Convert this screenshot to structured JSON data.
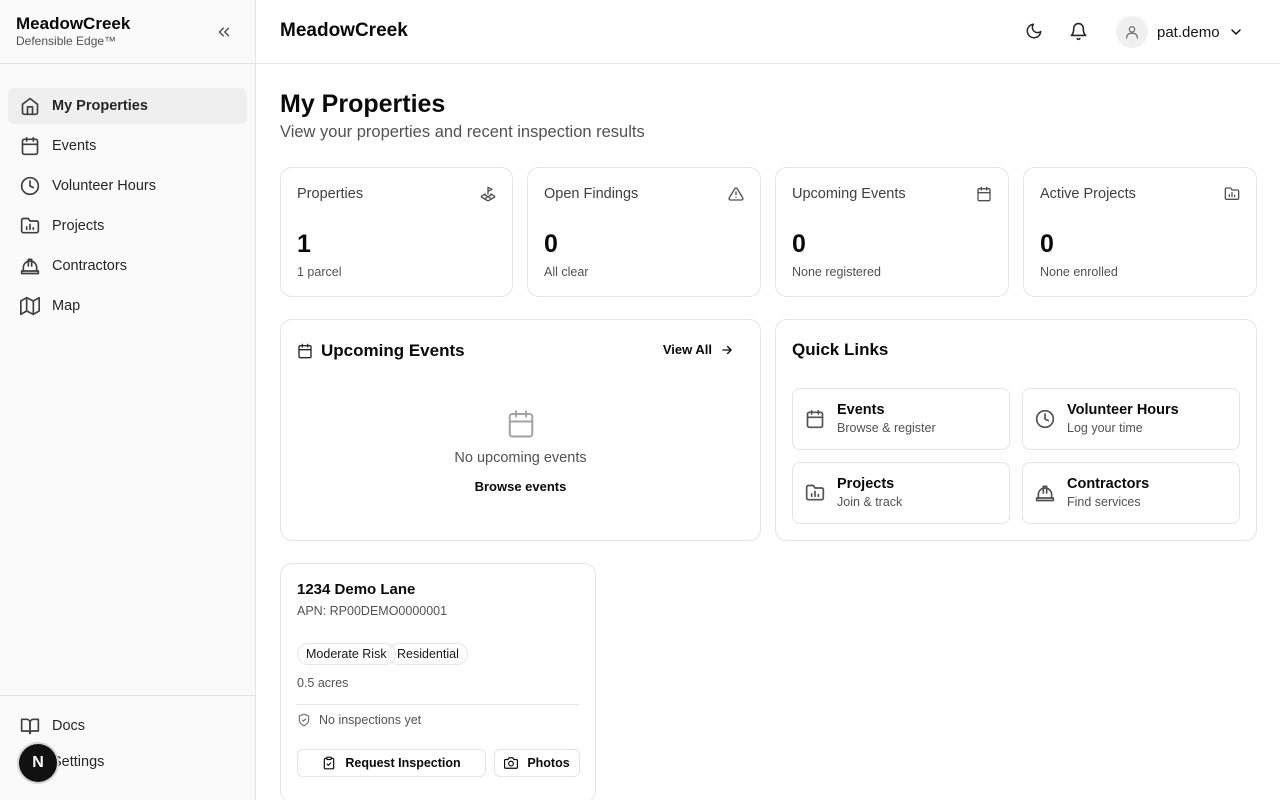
{
  "sidebar": {
    "brand_name": "MeadowCreek",
    "brand_sub": "Defensible Edge™",
    "items": [
      {
        "label": "My Properties",
        "icon": "home-icon"
      },
      {
        "label": "Events",
        "icon": "calendar-icon"
      },
      {
        "label": "Volunteer Hours",
        "icon": "clock-icon"
      },
      {
        "label": "Projects",
        "icon": "folder-chart-icon"
      },
      {
        "label": "Contractors",
        "icon": "hard-hat-icon"
      },
      {
        "label": "Map",
        "icon": "map-icon"
      }
    ],
    "bottom_items": [
      {
        "label": "Docs",
        "icon": "book-icon"
      },
      {
        "label": "Settings",
        "icon": "gear-icon"
      }
    ],
    "fab_letter": "N"
  },
  "header": {
    "title": "MeadowCreek",
    "username": "pat.demo"
  },
  "page": {
    "title": "My Properties",
    "subtitle": "View your properties and recent inspection results"
  },
  "stats": [
    {
      "label": "Properties",
      "value": "1",
      "note": "1 parcel",
      "icon": "land-plot-icon"
    },
    {
      "label": "Open Findings",
      "value": "0",
      "note": "All clear",
      "icon": "warning-triangle-icon"
    },
    {
      "label": "Upcoming Events",
      "value": "0",
      "note": "None registered",
      "icon": "calendar-icon"
    },
    {
      "label": "Active Projects",
      "value": "0",
      "note": "None enrolled",
      "icon": "folder-chart-icon"
    }
  ],
  "upcoming": {
    "title": "Upcoming Events",
    "view_all": "View All",
    "empty_text": "No upcoming events",
    "empty_link": "Browse events"
  },
  "quick_links": {
    "title": "Quick Links",
    "items": [
      {
        "title": "Events",
        "sub": "Browse & register",
        "icon": "calendar-icon"
      },
      {
        "title": "Volunteer Hours",
        "sub": "Log your time",
        "icon": "clock-icon"
      },
      {
        "title": "Projects",
        "sub": "Join & track",
        "icon": "folder-chart-icon"
      },
      {
        "title": "Contractors",
        "sub": "Find services",
        "icon": "hard-hat-icon"
      }
    ]
  },
  "property": {
    "address": "1234 Demo Lane",
    "apn": "APN: RP00DEMO0000001",
    "badges": [
      "Moderate Risk",
      "Residential"
    ],
    "acres": "0.5 acres",
    "inspection_status": "No inspections yet",
    "request_btn": "Request Inspection",
    "photos_btn": "Photos"
  }
}
